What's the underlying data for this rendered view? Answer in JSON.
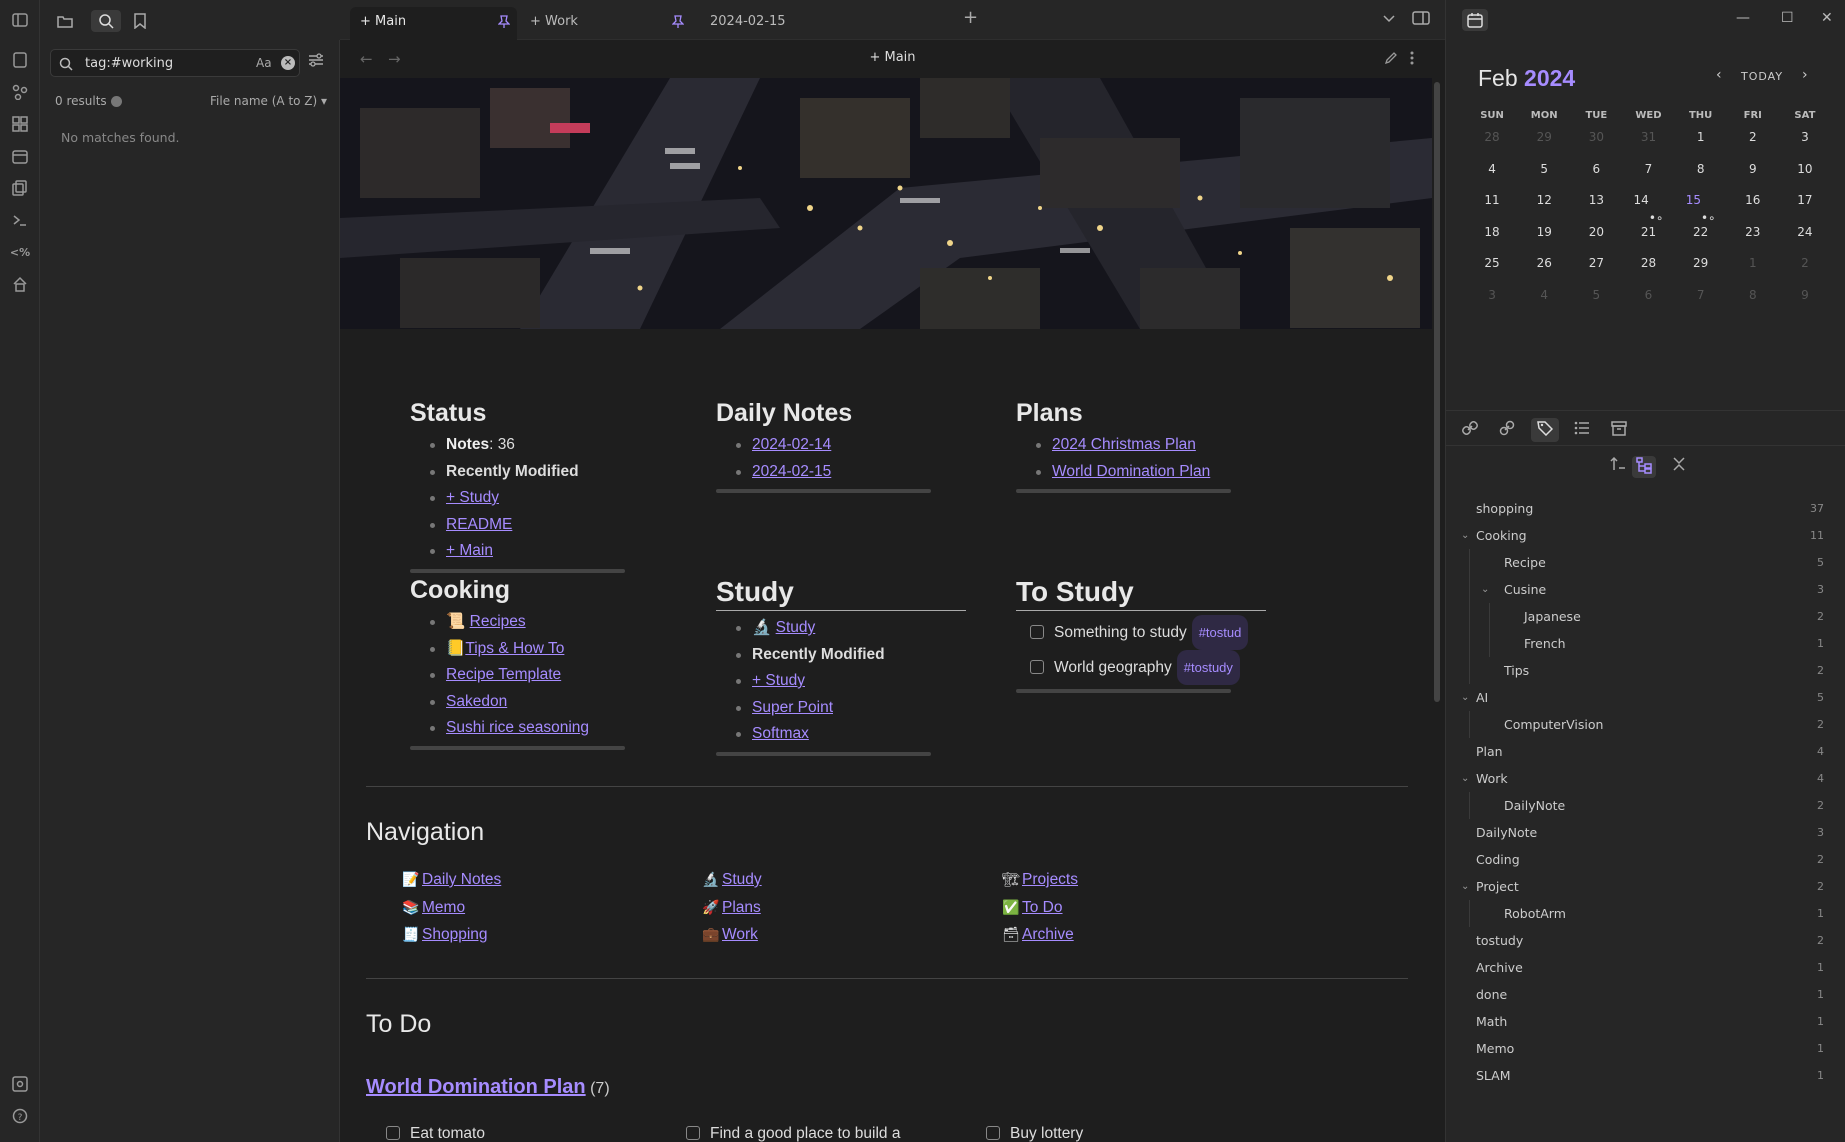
{
  "left_pane": {
    "search_value": "tag:#working",
    "match_case_label": "Aa",
    "results": "0 results",
    "sort": "File name (A to Z)",
    "no_matches": "No matches found."
  },
  "tabs": [
    {
      "label": "+ Main"
    },
    {
      "label": "+ Work"
    },
    {
      "label": "2024-02-15"
    }
  ],
  "editor": {
    "title": "+ Main"
  },
  "status": {
    "heading": "Status",
    "notes_label": "Notes",
    "notes_count": ": 36",
    "recently_modified": "Recently Modified",
    "links": [
      "+ Study",
      "README",
      "+ Main"
    ]
  },
  "daily_notes": {
    "heading": "Daily Notes",
    "links": [
      "2024-02-14",
      "2024-02-15"
    ]
  },
  "plans": {
    "heading": "Plans",
    "links": [
      "2024 Christmas Plan",
      "World Domination Plan"
    ]
  },
  "cooking": {
    "heading": "Cooking",
    "items": [
      {
        "emoji": "📜",
        "label": "Recipes"
      },
      {
        "emoji": "📒",
        "label": "Tips & How To"
      },
      {
        "emoji": "",
        "label": "Recipe Template"
      },
      {
        "emoji": "",
        "label": "Sakedon"
      },
      {
        "emoji": "",
        "label": "Sushi rice seasoning"
      }
    ]
  },
  "study": {
    "heading": "Study",
    "first_emoji": "🔬",
    "first_link": "Study",
    "recently_modified": "Recently Modified",
    "links": [
      "+ Study",
      "Super Point",
      "Softmax"
    ]
  },
  "to_study": {
    "heading": "To Study",
    "tasks": [
      {
        "label": "Something to study",
        "tag": "#tostud"
      },
      {
        "label": "World geography",
        "tag": "#tostudy"
      }
    ]
  },
  "navigation": {
    "heading": "Navigation",
    "col1": [
      {
        "emoji": "📝",
        "label": "Daily Notes"
      },
      {
        "emoji": "📚",
        "label": "Memo"
      },
      {
        "emoji": "🧾",
        "label": "Shopping"
      }
    ],
    "col2": [
      {
        "emoji": "🔬",
        "label": "Study"
      },
      {
        "emoji": "🚀",
        "label": "Plans"
      },
      {
        "emoji": "💼",
        "label": "Work"
      }
    ],
    "col3": [
      {
        "emoji": "🏗",
        "label": "Projects"
      },
      {
        "emoji": "✅",
        "label": "To Do"
      },
      {
        "emoji": "🗃",
        "label": "Archive"
      }
    ]
  },
  "todo": {
    "heading": "To Do",
    "plan_link": "World Domination Plan",
    "plan_count": "(7)",
    "tasks": [
      "Eat tomato",
      "Find a good place to build a",
      "Buy lottery"
    ]
  },
  "calendar": {
    "month": "Feb",
    "year": "2024",
    "today_label": "TODAY",
    "weekdays": [
      "SUN",
      "MON",
      "TUE",
      "WED",
      "THU",
      "FRI",
      "SAT"
    ],
    "weeks": [
      [
        "28",
        "29",
        "30",
        "31",
        "1",
        "2",
        "3"
      ],
      [
        "4",
        "5",
        "6",
        "7",
        "8",
        "9",
        "10"
      ],
      [
        "11",
        "12",
        "13",
        "14",
        "15",
        "16",
        "17"
      ],
      [
        "18",
        "19",
        "20",
        "21",
        "22",
        "23",
        "24"
      ],
      [
        "25",
        "26",
        "27",
        "28",
        "29",
        "1",
        "2"
      ],
      [
        "3",
        "4",
        "5",
        "6",
        "7",
        "8",
        "9"
      ]
    ],
    "selected_day": "15"
  },
  "tags": [
    {
      "name": "shopping",
      "count": "37",
      "depth": 0,
      "chev": false
    },
    {
      "name": "Cooking",
      "count": "11",
      "depth": 0,
      "chev": true
    },
    {
      "name": "Recipe",
      "count": "5",
      "depth": 1,
      "chev": false
    },
    {
      "name": "Cusine",
      "count": "3",
      "depth": 1,
      "chev": true
    },
    {
      "name": "Japanese",
      "count": "2",
      "depth": 2,
      "chev": false
    },
    {
      "name": "French",
      "count": "1",
      "depth": 2,
      "chev": false
    },
    {
      "name": "Tips",
      "count": "2",
      "depth": 1,
      "chev": false
    },
    {
      "name": "AI",
      "count": "5",
      "depth": 0,
      "chev": true
    },
    {
      "name": "ComputerVision",
      "count": "2",
      "depth": 1,
      "chev": false
    },
    {
      "name": "Plan",
      "count": "4",
      "depth": 0,
      "chev": false
    },
    {
      "name": "Work",
      "count": "4",
      "depth": 0,
      "chev": true
    },
    {
      "name": "DailyNote",
      "count": "2",
      "depth": 1,
      "chev": false
    },
    {
      "name": "DailyNote",
      "count": "3",
      "depth": 0,
      "chev": false
    },
    {
      "name": "Coding",
      "count": "2",
      "depth": 0,
      "chev": false
    },
    {
      "name": "Project",
      "count": "2",
      "depth": 0,
      "chev": true
    },
    {
      "name": "RobotArm",
      "count": "1",
      "depth": 1,
      "chev": false
    },
    {
      "name": "tostudy",
      "count": "2",
      "depth": 0,
      "chev": false
    },
    {
      "name": "Archive",
      "count": "1",
      "depth": 0,
      "chev": false
    },
    {
      "name": "done",
      "count": "1",
      "depth": 0,
      "chev": false
    },
    {
      "name": "Math",
      "count": "1",
      "depth": 0,
      "chev": false
    },
    {
      "name": "Memo",
      "count": "1",
      "depth": 0,
      "chev": false
    },
    {
      "name": "SLAM",
      "count": "1",
      "depth": 0,
      "chev": false
    }
  ],
  "accent_color": "#a68cff"
}
